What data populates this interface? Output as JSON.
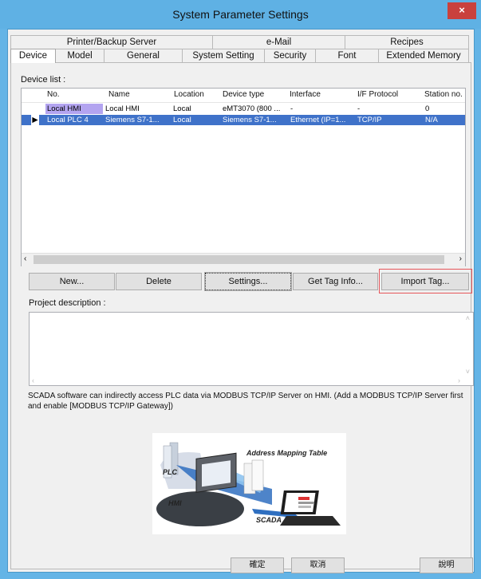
{
  "window": {
    "title": "System Parameter Settings",
    "close": "×"
  },
  "tabs_row1": [
    "Printer/Backup Server",
    "e-Mail",
    "Recipes"
  ],
  "tabs_row2": [
    "Device",
    "Model",
    "General",
    "System Setting",
    "Security",
    "Font",
    "Extended Memory"
  ],
  "device_list": {
    "label": "Device list :",
    "columns": [
      "No.",
      "Name",
      "Location",
      "Device type",
      "Interface",
      "I/F Protocol",
      "Station no."
    ],
    "rows": [
      {
        "no": "Local HMI",
        "name": "Local HMI",
        "location": "Local",
        "device_type": "eMT3070 (800 ...",
        "interface": "-",
        "protocol": "-",
        "station": "0"
      },
      {
        "no": "Local PLC 4",
        "name": "Siemens S7-1...",
        "location": "Local",
        "device_type": "Siemens S7-1...",
        "interface": "Ethernet (IP=1...",
        "protocol": "TCP/IP",
        "station": "N/A"
      }
    ]
  },
  "buttons": {
    "new": "New...",
    "delete": "Delete",
    "settings": "Settings...",
    "get_tag_info": "Get Tag Info...",
    "import_tag": "Import Tag..."
  },
  "project_description_label": "Project description :",
  "scada_info": "SCADA software can indirectly access PLC data via MODBUS TCP/IP Server on HMI. (Add a MODBUS TCP/IP Server first and enable [MODBUS TCP/IP Gateway])",
  "diagram": {
    "address_mapping": "Address Mapping Table",
    "plc": "PLC",
    "hmi": "HMI",
    "scada": "SCADA"
  },
  "footer": {
    "ok": "確定",
    "cancel": "取消",
    "help": "說明"
  },
  "colors": {
    "title_bar": "#5fb1e4",
    "selection": "#3f72c9",
    "highlight": "#e6555a"
  }
}
